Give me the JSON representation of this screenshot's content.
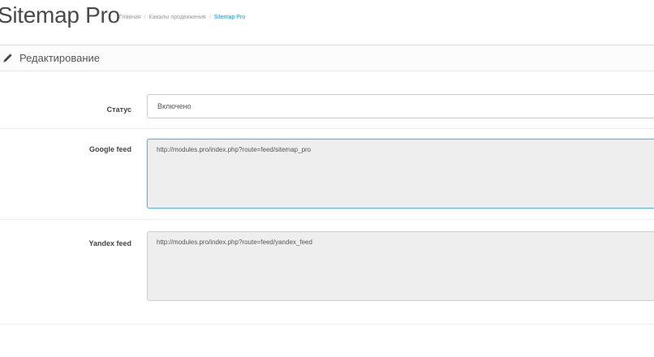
{
  "header": {
    "title": "Sitemap Pro",
    "breadcrumbs": [
      "Главная",
      "Каналы продвижения",
      "Sitemap Pro"
    ]
  },
  "panel": {
    "title": "Редактирование",
    "icon": "pencil-icon"
  },
  "form": {
    "status": {
      "label": "Статус",
      "value": "Включено"
    },
    "google_feed": {
      "label": "Google feed",
      "value": "http://modules.pro/index.php?route=feed/sitemap_pro"
    },
    "yandex_feed": {
      "label": "Yandex feed",
      "value": "http://modules.pro/index.php?route=feed/yandex_feed"
    }
  },
  "colors": {
    "accent": "#1e91cf",
    "focus_border": "#66afe9",
    "readonly_bg": "#eeeeee"
  }
}
